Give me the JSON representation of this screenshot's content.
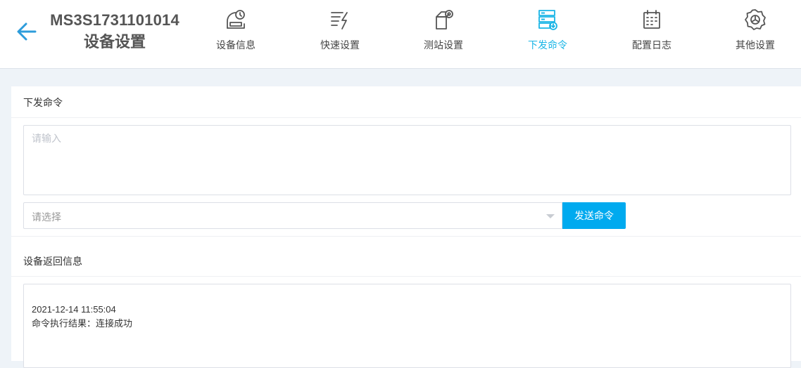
{
  "header": {
    "device_id": "MS3S1731101014",
    "page_title": "设备设置",
    "tabs": [
      {
        "label": "设备信息",
        "icon": "device-info-icon"
      },
      {
        "label": "快速设置",
        "icon": "quick-settings-icon"
      },
      {
        "label": "测站设置",
        "icon": "station-settings-icon"
      },
      {
        "label": "下发命令",
        "icon": "send-command-icon",
        "active": true
      },
      {
        "label": "配置日志",
        "icon": "config-log-icon"
      },
      {
        "label": "其他设置",
        "icon": "other-settings-icon"
      }
    ]
  },
  "command": {
    "section_title": "下发命令",
    "input_placeholder": "请输入",
    "select_placeholder": "请选择",
    "send_label": "发送命令"
  },
  "response": {
    "section_title": "设备返回信息",
    "timestamp": "2021-12-14 11:55:04",
    "result": "命令执行结果：连接成功"
  },
  "colors": {
    "accent": "#19b5e6",
    "button": "#00aaef",
    "back_arrow": "#2d9cdb"
  }
}
